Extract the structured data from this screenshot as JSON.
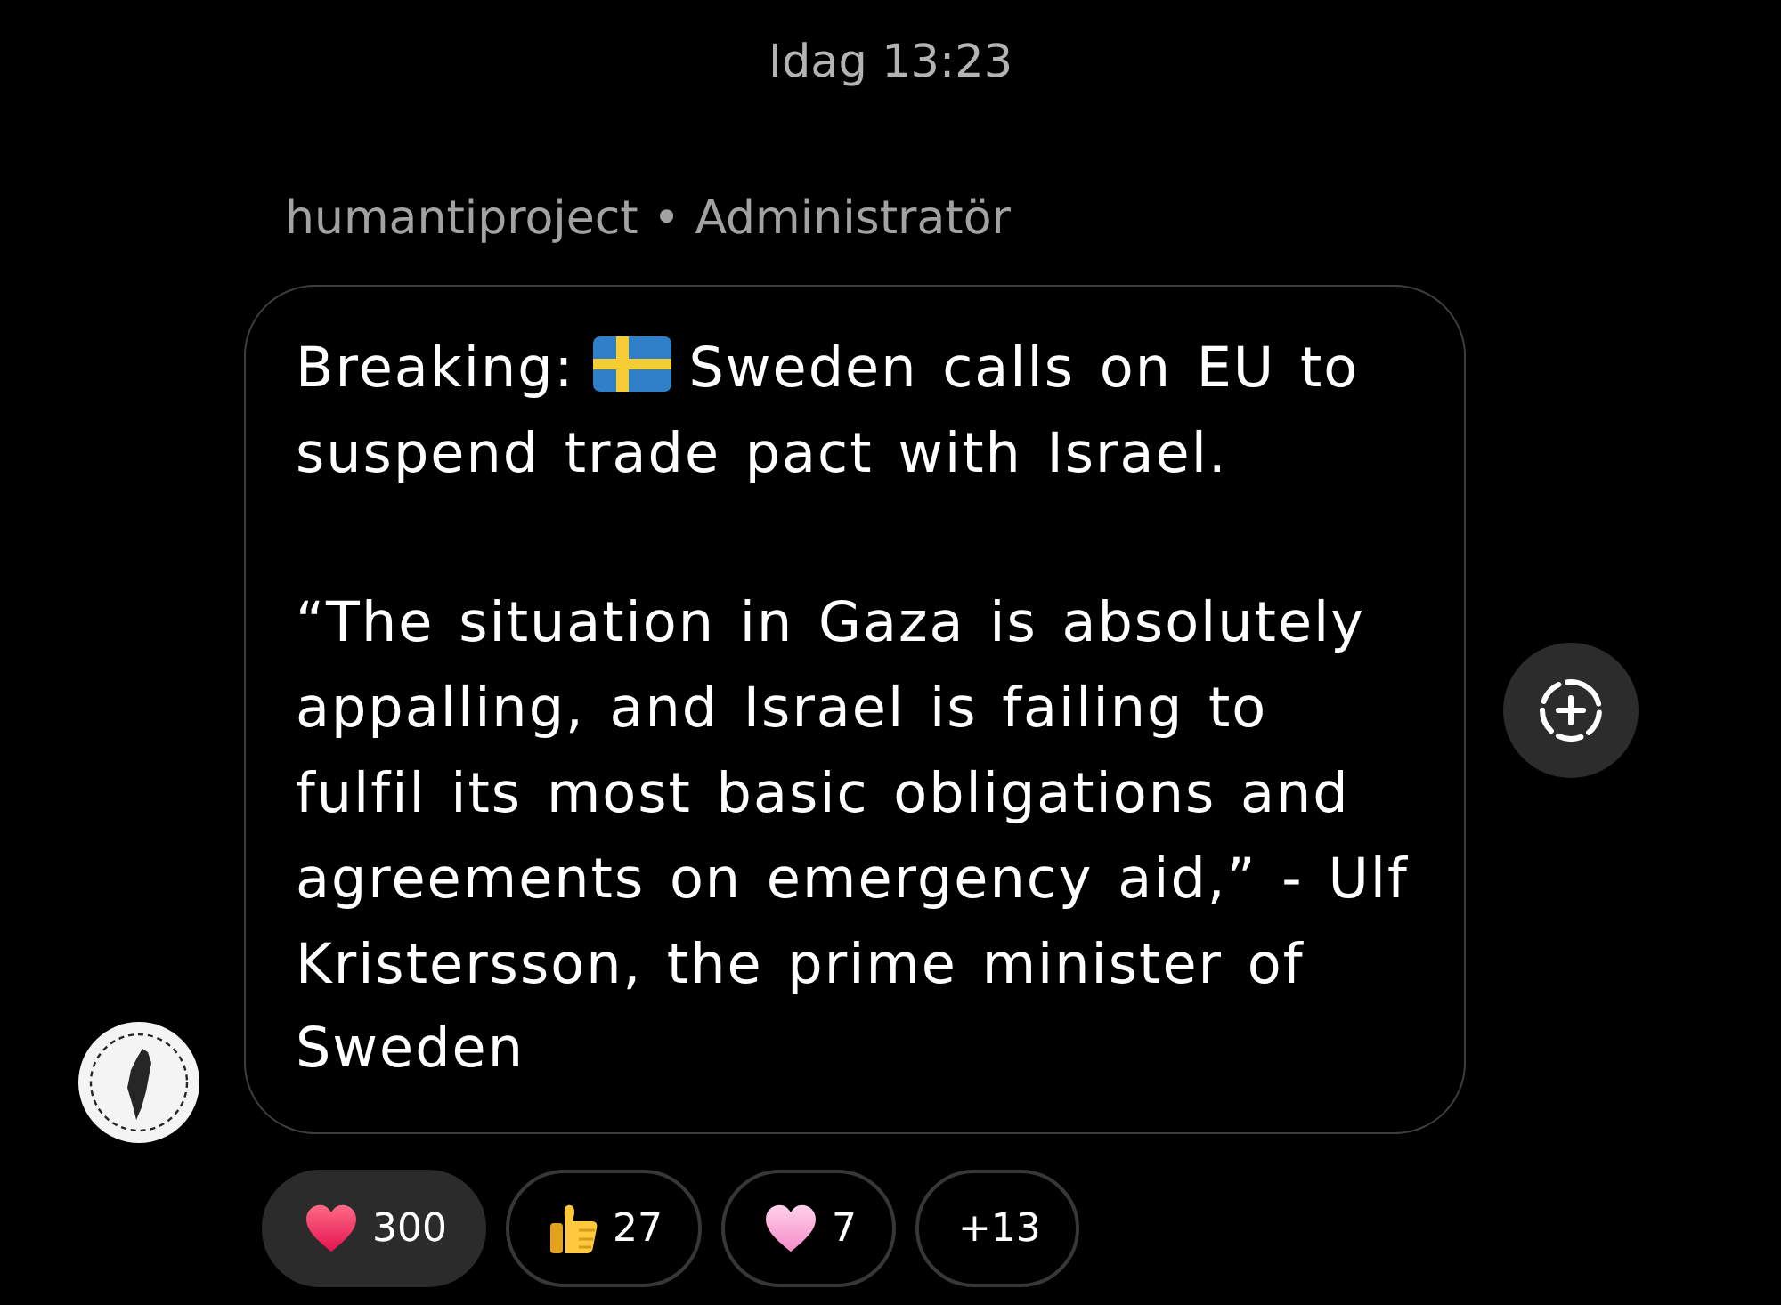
{
  "timestamp": "Idag 13:23",
  "message": {
    "sender": "humantiproject • Administratör",
    "headline_prefix": "Breaking:",
    "headline": "Sweden calls on EU to suspend trade pact with Israel.",
    "body": "“The situation in Gaza is absolutely appalling, and Israel is failing to fulfil its most basic obligations and agreements on emergency aid,” - Ulf Kristersson, the prime minister of Sweden"
  },
  "reactions": [
    {
      "kind": "red_heart",
      "count": "300",
      "selected": true
    },
    {
      "kind": "thumbs_up",
      "count": "27",
      "selected": false
    },
    {
      "kind": "pink_heart",
      "count": "7",
      "selected": false
    },
    {
      "kind": "more",
      "count": "+13",
      "selected": false
    }
  ]
}
